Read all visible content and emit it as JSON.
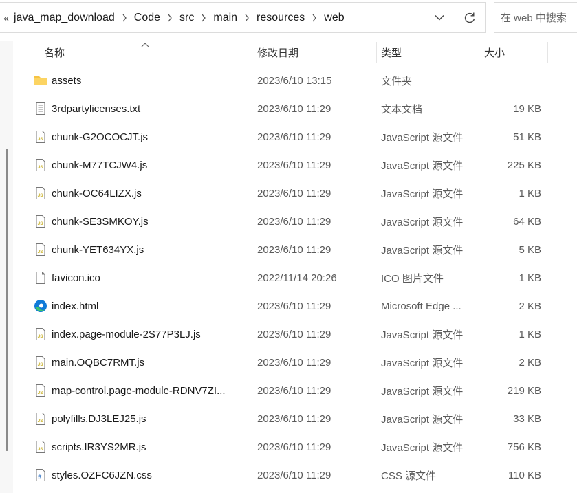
{
  "address_bar": {
    "overflow_label": "«",
    "breadcrumbs": [
      "java_map_download",
      "Code",
      "src",
      "main",
      "resources",
      "web"
    ],
    "dropdown_icon": "chevron-down-icon",
    "refresh_icon": "refresh-icon"
  },
  "search": {
    "placeholder": "在 web 中搜索"
  },
  "columns": {
    "name": "名称",
    "date": "修改日期",
    "type": "类型",
    "size": "大小"
  },
  "files": [
    {
      "name": "assets",
      "date": "2023/6/10 13:15",
      "type": "文件夹",
      "size": "",
      "icon": "folder-icon"
    },
    {
      "name": "3rdpartylicenses.txt",
      "date": "2023/6/10 11:29",
      "type": "文本文档",
      "size": "19 KB",
      "icon": "text-file-icon"
    },
    {
      "name": "chunk-G2OCOCJT.js",
      "date": "2023/6/10 11:29",
      "type": "JavaScript 源文件",
      "size": "51 KB",
      "icon": "js-file-icon"
    },
    {
      "name": "chunk-M77TCJW4.js",
      "date": "2023/6/10 11:29",
      "type": "JavaScript 源文件",
      "size": "225 KB",
      "icon": "js-file-icon"
    },
    {
      "name": "chunk-OC64LIZX.js",
      "date": "2023/6/10 11:29",
      "type": "JavaScript 源文件",
      "size": "1 KB",
      "icon": "js-file-icon"
    },
    {
      "name": "chunk-SE3SMKOY.js",
      "date": "2023/6/10 11:29",
      "type": "JavaScript 源文件",
      "size": "64 KB",
      "icon": "js-file-icon"
    },
    {
      "name": "chunk-YET634YX.js",
      "date": "2023/6/10 11:29",
      "type": "JavaScript 源文件",
      "size": "5 KB",
      "icon": "js-file-icon"
    },
    {
      "name": "favicon.ico",
      "date": "2022/11/14 20:26",
      "type": "ICO 图片文件",
      "size": "1 KB",
      "icon": "blank-file-icon"
    },
    {
      "name": "index.html",
      "date": "2023/6/10 11:29",
      "type": "Microsoft Edge ...",
      "size": "2 KB",
      "icon": "edge-icon"
    },
    {
      "name": "index.page-module-2S77P3LJ.js",
      "date": "2023/6/10 11:29",
      "type": "JavaScript 源文件",
      "size": "1 KB",
      "icon": "js-file-icon"
    },
    {
      "name": "main.OQBC7RMT.js",
      "date": "2023/6/10 11:29",
      "type": "JavaScript 源文件",
      "size": "2 KB",
      "icon": "js-file-icon"
    },
    {
      "name": "map-control.page-module-RDNV7ZI...",
      "date": "2023/6/10 11:29",
      "type": "JavaScript 源文件",
      "size": "219 KB",
      "icon": "js-file-icon"
    },
    {
      "name": "polyfills.DJ3LEJ25.js",
      "date": "2023/6/10 11:29",
      "type": "JavaScript 源文件",
      "size": "33 KB",
      "icon": "js-file-icon"
    },
    {
      "name": "scripts.IR3YS2MR.js",
      "date": "2023/6/10 11:29",
      "type": "JavaScript 源文件",
      "size": "756 KB",
      "icon": "js-file-icon"
    },
    {
      "name": "styles.OZFC6JZN.css",
      "date": "2023/6/10 11:29",
      "type": "CSS 源文件",
      "size": "110 KB",
      "icon": "css-file-icon"
    }
  ],
  "colors": {
    "folder": "#f6c343",
    "js_badge": "#c9b12a",
    "css_badge": "#3d7bc6",
    "edge_blue": "#0f7ad8",
    "edge_green": "#3cc26e"
  }
}
